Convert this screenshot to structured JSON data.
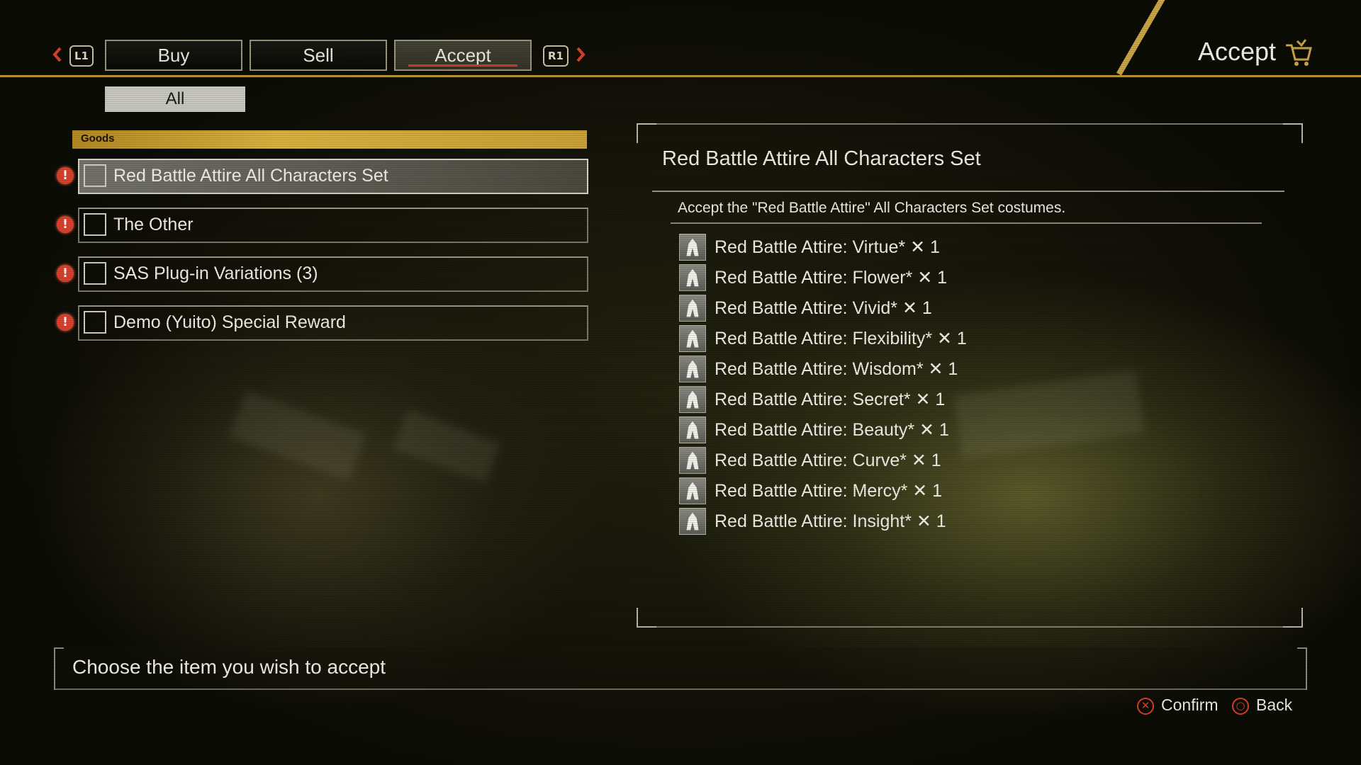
{
  "header": {
    "title": "Accept",
    "left_shoulder": "L1",
    "right_shoulder": "R1",
    "tabs": [
      {
        "label": "Buy",
        "active": false
      },
      {
        "label": "Sell",
        "active": false
      },
      {
        "label": "Accept",
        "active": true
      }
    ]
  },
  "filter": {
    "label": "All"
  },
  "category": {
    "label": "Goods"
  },
  "list": [
    {
      "label": "Red Battle Attire All Characters Set",
      "selected": true
    },
    {
      "label": "The Other",
      "selected": false
    },
    {
      "label": "SAS Plug-in Variations (3)",
      "selected": false
    },
    {
      "label": "Demo (Yuito) Special Reward",
      "selected": false
    }
  ],
  "detail": {
    "title": "Red Battle Attire All Characters Set",
    "description": "Accept the \"Red Battle Attire\" All Characters Set costumes.",
    "items": [
      "Red Battle Attire: Virtue* ✕ 1",
      "Red Battle Attire: Flower* ✕ 1",
      "Red Battle Attire: Vivid* ✕ 1",
      "Red Battle Attire: Flexibility* ✕ 1",
      "Red Battle Attire: Wisdom* ✕ 1",
      "Red Battle Attire: Secret* ✕ 1",
      "Red Battle Attire: Beauty* ✕ 1",
      "Red Battle Attire: Curve* ✕ 1",
      "Red Battle Attire: Mercy* ✕ 1",
      "Red Battle Attire: Insight* ✕ 1"
    ]
  },
  "help": {
    "text": "Choose the item you wish to accept"
  },
  "hints": {
    "confirm": "Confirm",
    "back": "Back"
  },
  "colors": {
    "accent": "#c9a548",
    "alert": "#d8412d",
    "tab_underline": "#d63a2a"
  }
}
